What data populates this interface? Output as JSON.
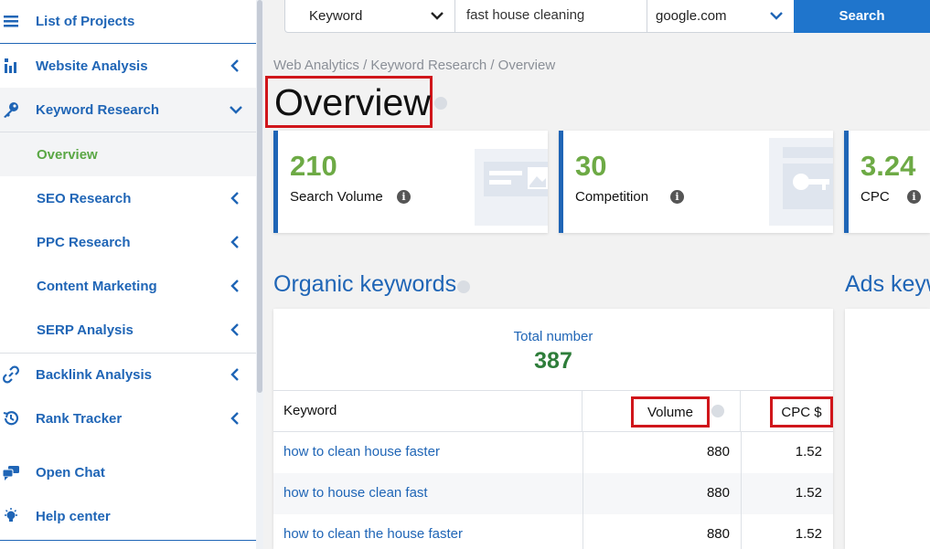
{
  "sidebar": {
    "items": [
      {
        "label": "List of Projects",
        "icon": "list-icon"
      },
      {
        "label": "Website Analysis",
        "icon": "analytics-icon"
      },
      {
        "label": "Keyword Research",
        "icon": "key-icon"
      },
      {
        "label": "Overview"
      },
      {
        "label": "SEO Research"
      },
      {
        "label": "PPC Research"
      },
      {
        "label": "Content Marketing"
      },
      {
        "label": "SERP Analysis"
      },
      {
        "label": "Backlink Analysis",
        "icon": "link-icon"
      },
      {
        "label": "Rank Tracker",
        "icon": "history-icon"
      },
      {
        "label": "Open Chat",
        "icon": "chat-icon"
      },
      {
        "label": "Help center",
        "icon": "bulb-icon"
      }
    ]
  },
  "search": {
    "type_value": "Keyword",
    "keyword_value": "fast house cleaning",
    "engine_value": "google.com",
    "button_label": "Search"
  },
  "breadcrumb": "Web Analytics / Keyword Research / Overview",
  "page_title": "Overview",
  "metrics": [
    {
      "value": "210",
      "label": "Search Volume"
    },
    {
      "value": "30",
      "label": "Competition"
    },
    {
      "value": "3.24",
      "label": "CPC"
    }
  ],
  "organic": {
    "title": "Organic keywords",
    "total_label": "Total number",
    "total_value": "387",
    "columns": [
      "Keyword",
      "Volume",
      "CPC $"
    ],
    "rows": [
      {
        "keyword": "how to clean house faster",
        "volume": "880",
        "cpc": "1.52"
      },
      {
        "keyword": "how to house clean fast",
        "volume": "880",
        "cpc": "1.52"
      },
      {
        "keyword": "how to clean the house faster",
        "volume": "880",
        "cpc": "1.52"
      }
    ]
  },
  "ads": {
    "title": "Ads keywords"
  },
  "colors": {
    "brand_blue": "#1f65b6",
    "button_blue": "#1f75cc",
    "metric_green": "#6daa45",
    "highlight_red": "#d0161b"
  }
}
